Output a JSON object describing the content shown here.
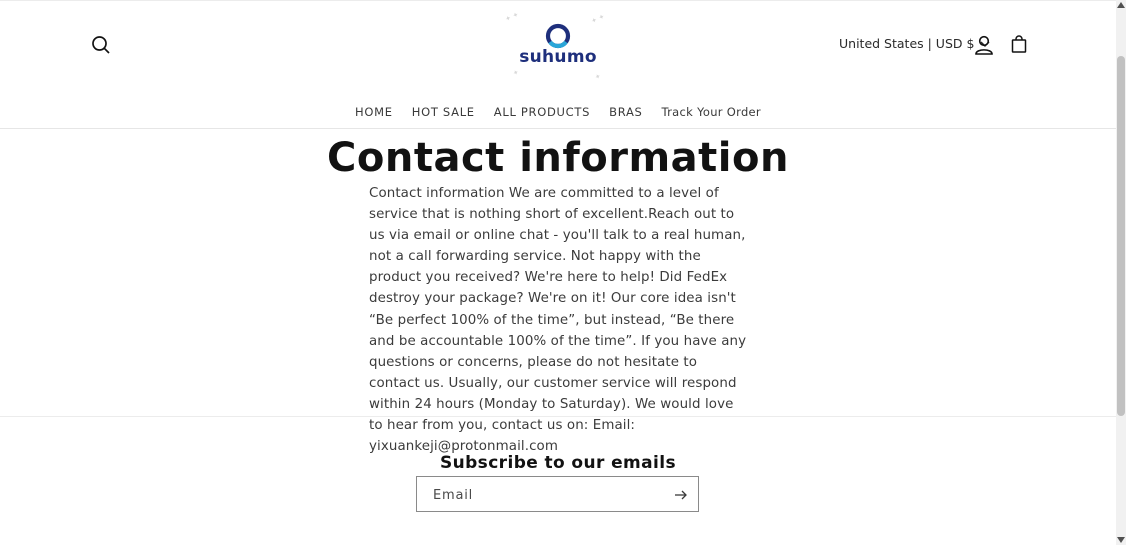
{
  "header": {
    "logo_text": "suhumo",
    "locale_label": "United States | USD $",
    "icons": {
      "search": "search-icon",
      "account": "user-icon",
      "cart": "shopping-bag-icon",
      "locale_chevron": "chevron-down-icon"
    },
    "brand_color": "#1e2f7c"
  },
  "nav": {
    "items": [
      {
        "label": "HOME"
      },
      {
        "label": "HOT SALE"
      },
      {
        "label": "ALL PRODUCTS"
      },
      {
        "label": "BRAS"
      },
      {
        "label": "Track Your Order"
      }
    ]
  },
  "main": {
    "title": "Contact information",
    "body": "Contact information We are committed to a level of service that is nothing short of excellent.Reach out to us via email or online chat - you'll talk to a real human, not a call forwarding service. Not happy with the product you received? We're here to help! Did FedEx destroy your package? We're on it! Our core idea isn't “Be perfect 100% of the time”, but instead, “Be there and be accountable 100% of the time”. If you have any questions or concerns, please do not hesitate to contact us. Usually, our customer service will respond within 24 hours (Monday to Saturday). We would love to hear from you, contact us on: Email: yixuankeji@protonmail.com"
  },
  "footer": {
    "subscribe_title": "Subscribe to our emails",
    "email_placeholder": "Email",
    "email_value": "",
    "submit_icon": "arrow-right-icon"
  }
}
